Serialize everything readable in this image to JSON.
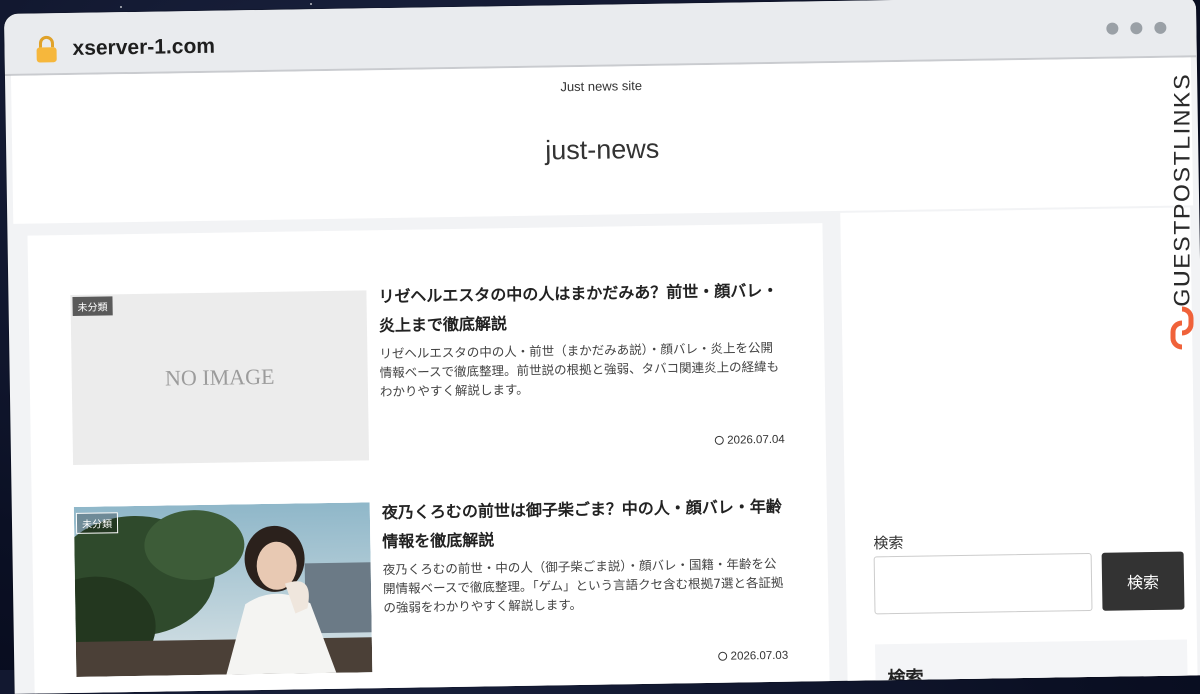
{
  "browser": {
    "domain": "xserver-1.com"
  },
  "site": {
    "tagline": "Just news site",
    "logo": "just-news"
  },
  "posts": [
    {
      "category": "未分類",
      "thumbnail_text": "NO IMAGE",
      "title": "リゼヘルエスタの中の人はまかだみあ？前世・顔バレ・炎上まで徹底解説",
      "snippet": "リゼヘルエスタの中の人・前世（まかだみあ説）・顔バレ・炎上を公開情報ベースで徹底整理。前世説の根拠と強弱、タバコ関連炎上の経緯もわかりやすく解説します。",
      "date": "2026.07.04"
    },
    {
      "category": "未分類",
      "title": "夜乃くろむの前世は御子柴ごま？中の人・顔バレ・年齢情報を徹底解説",
      "snippet": "夜乃くろむの前世・中の人（御子柴ごま説）・顔バレ・国籍・年齢を公開情報ベースで徹底整理。「ゲム」という言語クセ含む根拠7選と各証拠の強弱をわかりやすく解説します。",
      "date": "2026.07.03"
    }
  ],
  "sidebar": {
    "search_label": "検索",
    "search_placeholder": "",
    "search_button": "検索",
    "widget_title": "検索"
  },
  "watermark": {
    "text": "GUESTPOSTLINKS"
  },
  "colors": {
    "accent_button": "#333333",
    "watermark_icon": "#f0623a"
  }
}
